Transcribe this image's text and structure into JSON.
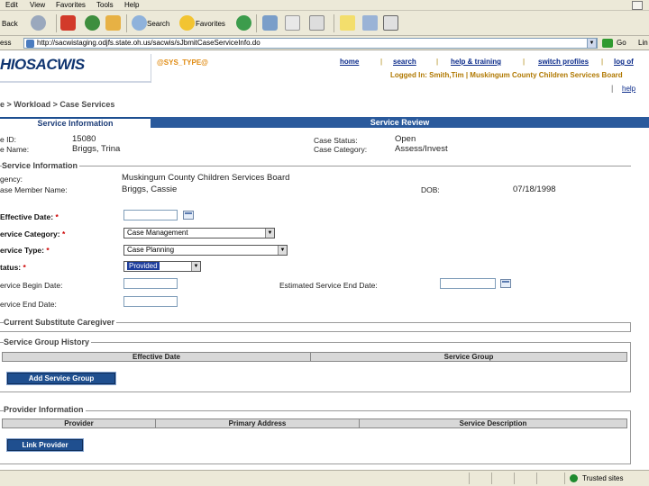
{
  "browser": {
    "menu": [
      "Edit",
      "View",
      "Favorites",
      "Tools",
      "Help"
    ],
    "toolbar": {
      "back": "Back",
      "search": "Search",
      "favorites": "Favorites"
    },
    "address_label": "ess",
    "url": "http://sacwistaging.odjfs.state.oh.us/sacwis/sJbmitCaseServiceInfo.do",
    "go_label": "Go",
    "links_label": "Lin",
    "status": {
      "trusted": "Trusted sites"
    }
  },
  "app": {
    "logo": "HIOSACWIS",
    "env": "@SYS_TYPE@",
    "nav": [
      "home",
      "search",
      "help & training",
      "switch profiles",
      "log of"
    ],
    "logged_in": "Logged In: Smith,Tim | Muskingum County Children Services Board",
    "help": "help"
  },
  "breadcrumb": "e > Workload > Case Services",
  "tabs": {
    "active": "Service Information",
    "inactive": "Service Review"
  },
  "summary": {
    "case_id_label": "e ID:",
    "case_id": "15080",
    "case_name_label": "e Name:",
    "case_name": "Briggs, Trina",
    "status_label": "Case Status:",
    "status": "Open",
    "category_label": "Case Category:",
    "category": "Assess/Invest"
  },
  "service_info": {
    "title": "Service Information",
    "agency_label": "gency:",
    "agency": "Muskingum County Children Services Board",
    "member_label": "ase Member Name:",
    "member": "Briggs, Cassie",
    "dob_label": "DOB:",
    "dob": "07/18/1998",
    "effective_label": "Effective Date:",
    "category_label": "ervice Category:",
    "category_value": "Case Management",
    "type_label": "ervice Type:",
    "type_value": "Case Planning",
    "status_label": "tatus:",
    "status_value": "Provided",
    "begin_label": "ervice Begin Date:",
    "est_end_label": "Estimated Service End Date:",
    "end_label": "ervice End Date:",
    "asterisk": "*"
  },
  "caregiver": {
    "title": "Current Substitute Caregiver"
  },
  "group_history": {
    "title": "Service Group History",
    "columns": [
      "Effective Date",
      "Service Group"
    ],
    "add_button": "Add Service Group"
  },
  "provider": {
    "title": "Provider Information",
    "columns": [
      "Provider",
      "Primary Address",
      "Service Description"
    ],
    "link_button": "Link Provider"
  }
}
